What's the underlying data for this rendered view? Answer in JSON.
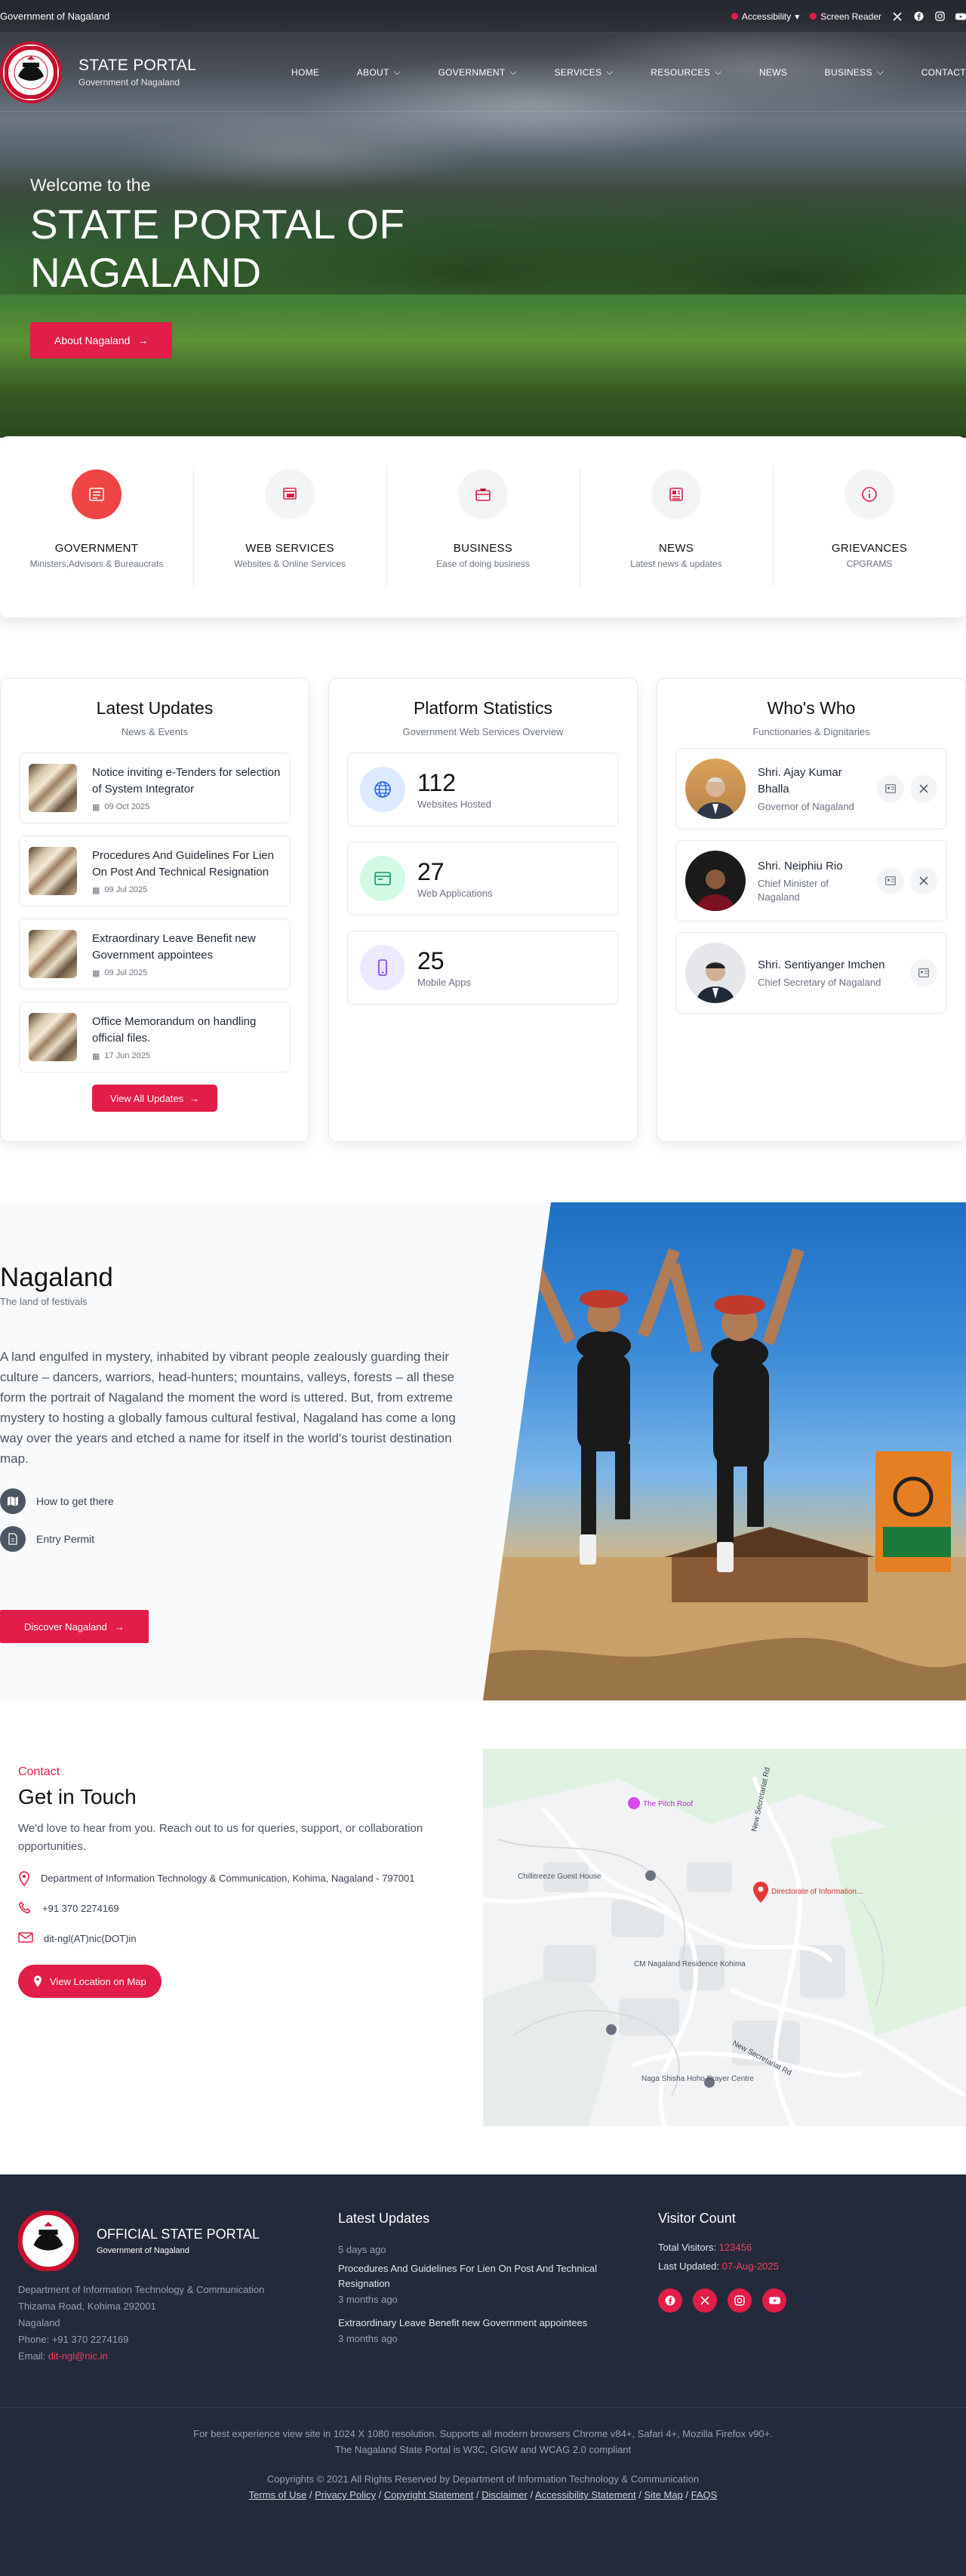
{
  "topbar": {
    "gov": "Government of Nagaland",
    "accessibility": "Accessibility",
    "screen_reader": "Screen Reader"
  },
  "brand": {
    "title": "STATE PORTAL",
    "subtitle": "Government of Nagaland"
  },
  "menu": [
    "HOME",
    "ABOUT",
    "GOVERNMENT",
    "SERVICES",
    "RESOURCES",
    "NEWS",
    "BUSINESS",
    "CONTACT"
  ],
  "hero": {
    "welcome": "Welcome to the",
    "line1": "STATE PORTAL OF",
    "line2": "NAGALAND",
    "button": "About Nagaland"
  },
  "quick": [
    {
      "title": "GOVERNMENT",
      "sub": "Ministers,Advisors & Bureaucrats",
      "icon": "government-icon"
    },
    {
      "title": "WEB SERVICES",
      "sub": "Websites & Online Services",
      "icon": "web-services-icon"
    },
    {
      "title": "BUSINESS",
      "sub": "Ease of doing business",
      "icon": "briefcase-icon"
    },
    {
      "title": "NEWS",
      "sub": "Latest news & updates",
      "icon": "newspaper-icon"
    },
    {
      "title": "GRIEVANCES",
      "sub": "CPGRAMS",
      "icon": "info-icon"
    }
  ],
  "updates": {
    "title": "Latest Updates",
    "sub": "News & Events",
    "items": [
      {
        "title": "Notice inviting e-Tenders for selection of System Integrator",
        "date": "09 Oct 2025"
      },
      {
        "title": "Procedures And Guidelines For Lien On Post And Technical Resignation",
        "date": "09 Jul 2025"
      },
      {
        "title": "Extraordinary Leave Benefit new Government appointees",
        "date": "09 Jul 2025"
      },
      {
        "title": "Office Memorandum on handling official files.",
        "date": "17 Jun 2025"
      }
    ],
    "button": "View All Updates"
  },
  "stats": {
    "title": "Platform Statistics",
    "sub": "Government Web Services Overview",
    "items": [
      {
        "value": "112",
        "label": "Websites Hosted",
        "color": "#2563eb"
      },
      {
        "value": "27",
        "label": "Web Applications",
        "color": "#059669"
      },
      {
        "value": "25",
        "label": "Mobile Apps",
        "color": "#7c3aed"
      }
    ]
  },
  "whoswho": {
    "title": "Who's Who",
    "sub": "Functionaries & Dignitaries",
    "people": [
      {
        "name": "Shri. Ajay Kumar Bhalla",
        "role": "Governor of Nagaland"
      },
      {
        "name": "Shri. Neiphiu Rio",
        "role": "Chief Minister of Nagaland"
      },
      {
        "name": "Shri. Sentiyanger Imchen",
        "role": "Chief Secretary of Nagaland"
      }
    ]
  },
  "nagaland": {
    "title": "Nagaland",
    "tagline": "The land of festivals",
    "text": "A land engulfed in mystery, inhabited by vibrant people zealously guarding their culture – dancers, warriors, head-hunters; mountains, valleys, forests – all these form the portrait of Nagaland the moment the word is uttered. But, from extreme mystery to hosting a globally famous cultural festival, Nagaland has come a long way over the years and etched a name for itself in the world's tourist destination map.",
    "links": [
      "How to get there",
      "Entry Permit"
    ],
    "button": "Discover Nagaland"
  },
  "contact": {
    "label": "Contact",
    "title": "Get in Touch",
    "desc": "We'd love to hear from you. Reach out to us for queries, support, or collaboration opportunities.",
    "address": "Department of Information Technology & Communication, Kohima, Nagaland - 797001",
    "phone": "+91 370 2274169",
    "email": "dit-ngl(AT)nic(DOT)in",
    "button": "View Location on Map",
    "map_labels": {
      "pitch": "The Pitch Roof",
      "guest": "Chillitreeze Guest House",
      "directorate": "Directorate of Information...",
      "cm": "CM Nagaland Residence Kohima",
      "church": "Naga Shisha Hoho Prayer Centre",
      "road1": "New Secretariat Rd",
      "road2": "New Secretariat Rd"
    }
  },
  "footer": {
    "title": "OFFICIAL STATE PORTAL",
    "sub": "Government of Nagaland",
    "address_lines": [
      "Department of Information Technology & Communication",
      "Thizama Road, Kohima 292001",
      "Nagaland"
    ],
    "phone_label": "Phone:",
    "phone": "+91 370 2274169",
    "email_label": "Email:",
    "email": "dit-ngl@nic.in",
    "updates_title": "Latest Updates",
    "updates": [
      {
        "when": "5 days ago",
        "title": "Procedures And Guidelines For Lien On Post And Technical Resignation",
        "age": "3 months ago"
      },
      {
        "title": "Extraordinary Leave Benefit new Government appointees",
        "age": "3 months ago"
      }
    ],
    "visitor_title": "Visitor Count",
    "visitors_label": "Total Visitors:",
    "visitors": "123456",
    "updated_label": "Last Updated:",
    "updated": "07-Aug-2025",
    "best": "For best experience view site in 1024 X 1080 resolution. Supports all modern browsers Chrome v84+, Safari 4+, Mozilla Firefox v90+.",
    "compliance": "The Nagaland State Portal is W3C, GIGW and WCAG 2.0 compliant",
    "copyright": "Copyrights © 2021 All Rights Reserved by Department of Information Technology & Communication",
    "links": [
      "Terms of Use",
      "Privacy Policy",
      "Copyright Statement",
      "Disclaimer",
      "Accessibility Statement",
      "Site Map",
      "FAQS"
    ]
  }
}
